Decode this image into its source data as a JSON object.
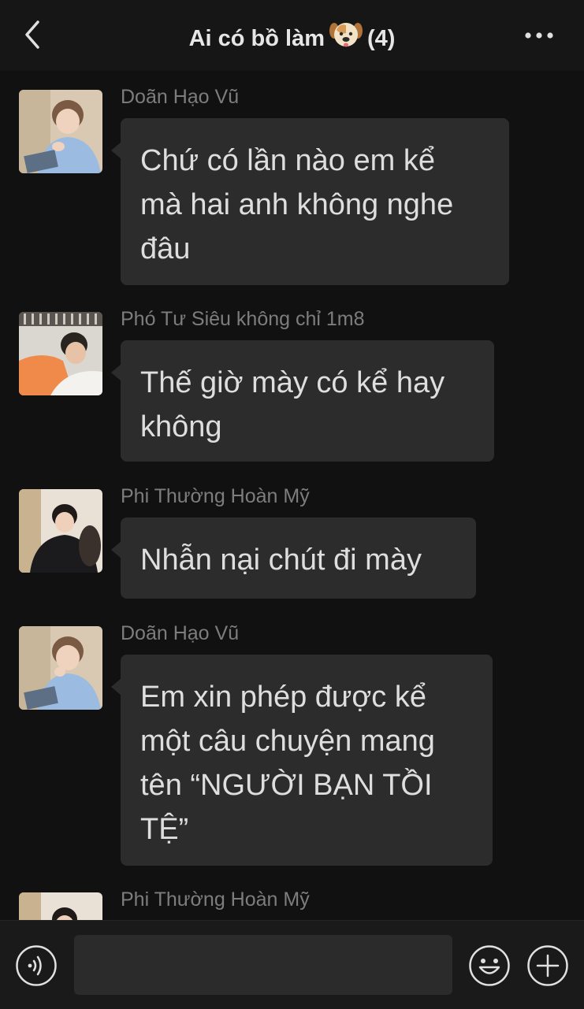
{
  "header": {
    "title": "Ai có bồ làm",
    "title_emoji": "dog-face-emoji",
    "member_count": "(4)",
    "back_icon": "chevron-left-icon",
    "more_icon": "more-dots-icon"
  },
  "messages": [
    {
      "sender": "Doãn Hạo Vũ",
      "avatar": "avatar-blue-shirt-reading",
      "lines": [
        "Chứ có lần nào em kể",
        "mà hai anh không nghe",
        "đâu"
      ]
    },
    {
      "sender": "Phó Tư Siêu không chỉ 1m8",
      "avatar": "avatar-orange-shirt",
      "lines": [
        "Thế giờ mày có kể hay",
        "không"
      ]
    },
    {
      "sender": "Phi Thường Hoàn Mỹ",
      "avatar": "avatar-black-suit",
      "lines": [
        "Nhẫn nại chút đi mày"
      ]
    },
    {
      "sender": "Doãn Hạo Vũ",
      "avatar": "avatar-blue-shirt-reading",
      "lines": [
        "Em xin phép được kể",
        "một câu chuyện mang",
        "tên “NGƯỜI BẠN TỒI",
        "TỆ”"
      ]
    },
    {
      "sender": "Phi Thường Hoàn Mỹ",
      "avatar": "avatar-black-suit",
      "lines": []
    }
  ],
  "input_bar": {
    "voice_icon": "voice-icon",
    "input_value": "",
    "emoji_icon": "smiley-icon",
    "add_icon": "plus-circle-icon"
  },
  "colors": {
    "background": "#111111",
    "header": "#161616",
    "bubble": "#2c2c2c",
    "bubble_text": "#dedede",
    "sender_text": "#7d7d7d"
  }
}
